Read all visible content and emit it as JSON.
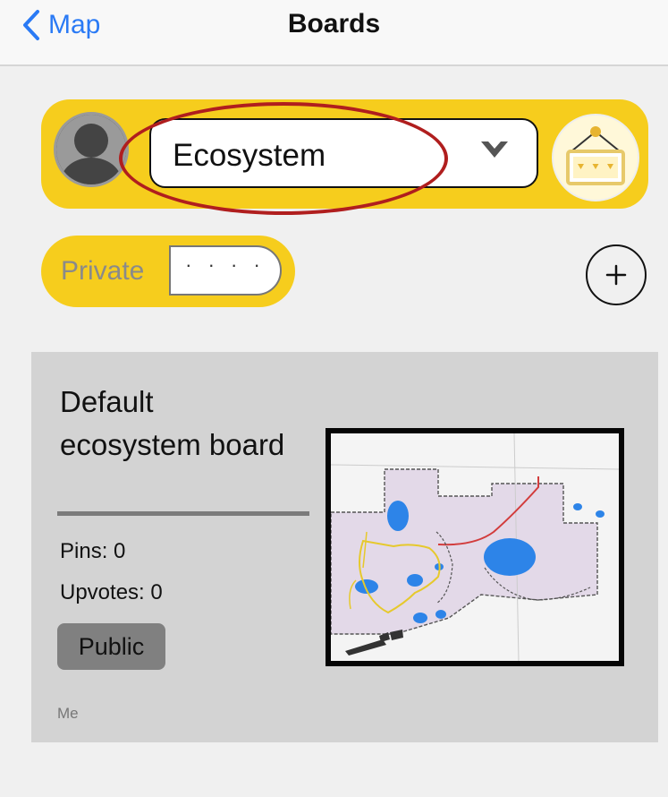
{
  "nav": {
    "back_label": "Map",
    "title": "Boards"
  },
  "selector": {
    "value": "Ecosystem",
    "badge_icon": "gems-board-icon"
  },
  "privacy": {
    "label": "Private",
    "toggle_value": "· · · ·"
  },
  "add_button": {
    "icon": "plus-icon"
  },
  "board": {
    "title": "Default ecosystem board",
    "pins": "Pins: 0",
    "upvotes": "Upvotes: 0",
    "visibility": "Public",
    "owner": "Me",
    "thumbnail": "trail-map-thumbnail"
  },
  "colors": {
    "accent": "#f6cd1d",
    "link": "#2a7af5",
    "highlight": "#b01e1e",
    "card": "#d3d3d3"
  }
}
